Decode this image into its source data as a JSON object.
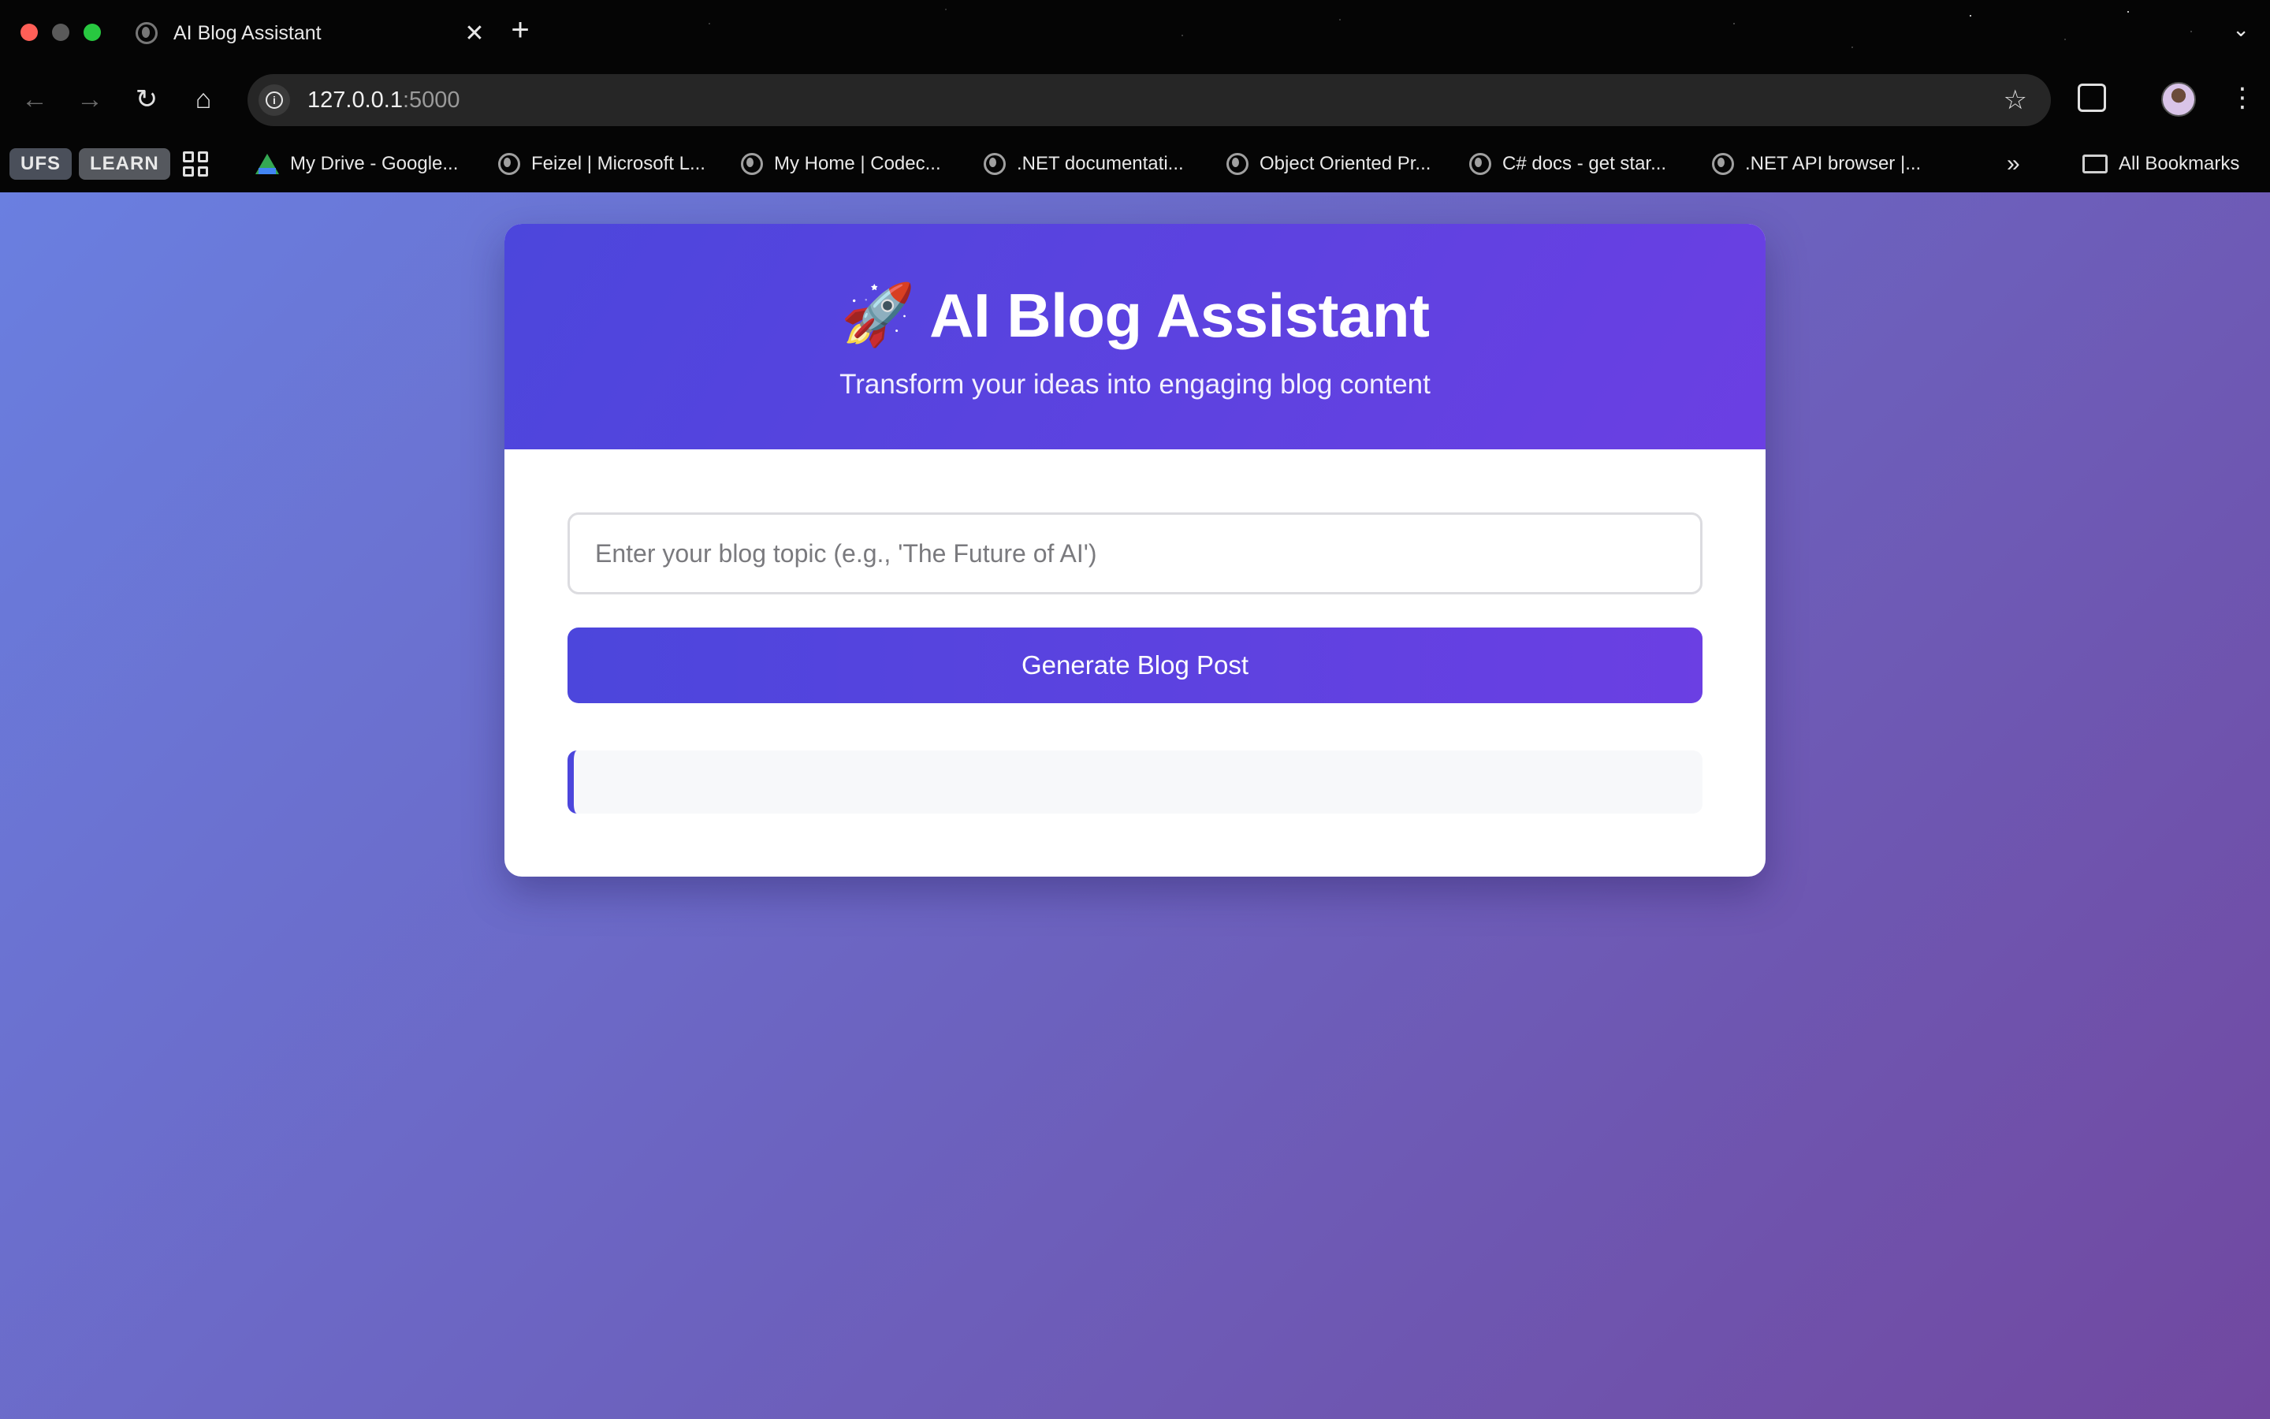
{
  "browser": {
    "tab": {
      "title": "AI Blog Assistant",
      "close_glyph": "✕"
    },
    "new_tab_glyph": "+",
    "tab_menu_glyph": "⌄",
    "nav": {
      "back": "←",
      "forward": "→",
      "reload": "↻",
      "home": "⌂",
      "star": "☆",
      "kebab": "⋮"
    },
    "url": {
      "host": "127.0.0.1",
      "port": ":5000"
    },
    "bookmarks": {
      "chips": [
        "UFS",
        "LEARN"
      ],
      "items": [
        {
          "label": "My Drive - Google...",
          "icon": "google-drive-icon"
        },
        {
          "label": "Feizel | Microsoft L...",
          "icon": "globe-icon"
        },
        {
          "label": "My Home | Codec...",
          "icon": "globe-icon"
        },
        {
          "label": ".NET documentati...",
          "icon": "globe-icon"
        },
        {
          "label": "Object Oriented Pr...",
          "icon": "globe-icon"
        },
        {
          "label": "C# docs - get star...",
          "icon": "globe-icon"
        },
        {
          "label": ".NET API browser |...",
          "icon": "globe-icon"
        }
      ],
      "more_glyph": "»",
      "all_bookmarks": "All Bookmarks"
    }
  },
  "app": {
    "header": {
      "icon": "🚀",
      "title": "AI Blog Assistant",
      "subtitle": "Transform your ideas into engaging blog content"
    },
    "form": {
      "topic_placeholder": "Enter your blog topic (e.g., 'The Future of AI')",
      "topic_value": "",
      "generate_label": "Generate Blog Post"
    },
    "output": {
      "text": ""
    }
  },
  "colors": {
    "accent_start": "#4c46dc",
    "accent_end": "#6b3fe3",
    "background_start": "#6a7fe0",
    "background_end": "#7148a0"
  }
}
